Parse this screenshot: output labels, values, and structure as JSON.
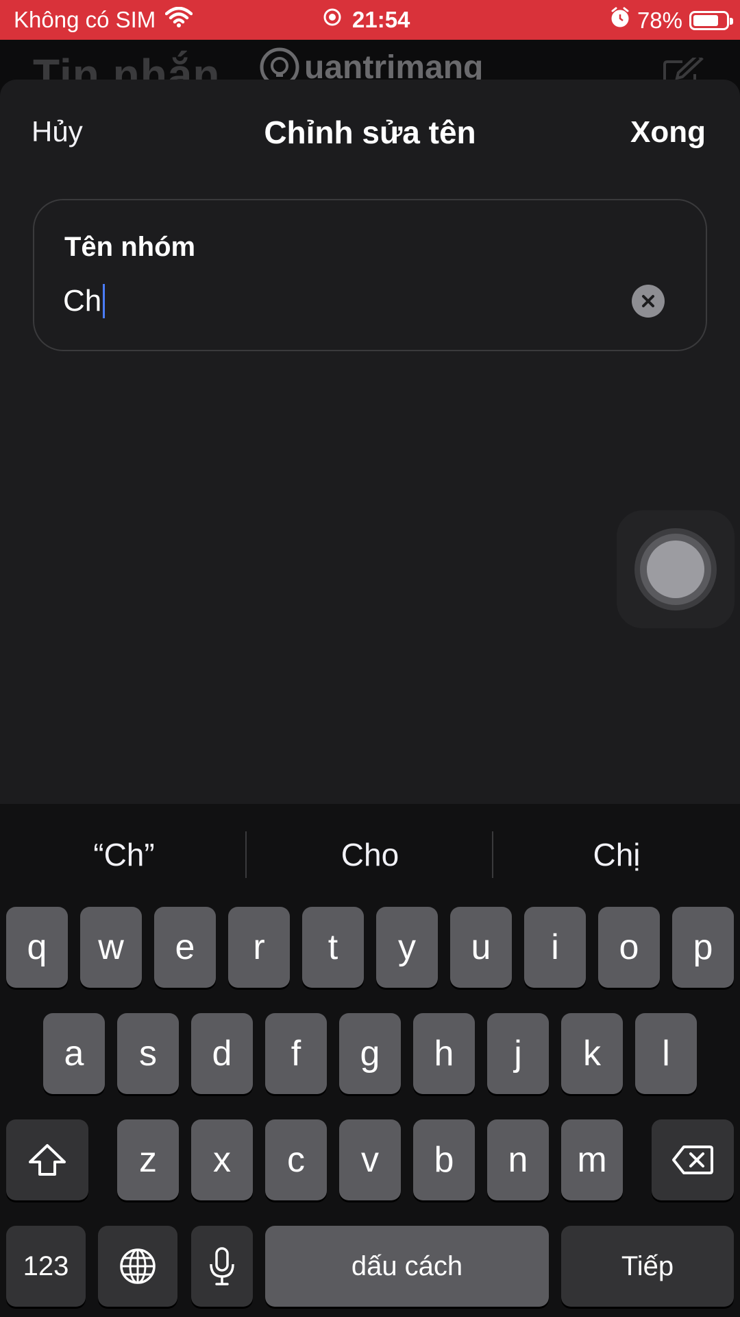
{
  "status_bar": {
    "carrier": "Không có SIM",
    "time": "21:54",
    "battery_percent": "78%",
    "battery_level": 0.78,
    "icons": [
      "wifi-icon",
      "screen-record-icon",
      "alarm-icon",
      "battery-icon"
    ],
    "background_color": "#d9323a"
  },
  "background": {
    "title": "Tin nhắn",
    "watermark": "uantrimang"
  },
  "sheet": {
    "cancel_label": "Hủy",
    "title": "Chỉnh sửa tên",
    "done_label": "Xong"
  },
  "field": {
    "label": "Tên nhóm",
    "value": "Ch"
  },
  "keyboard": {
    "suggestions": [
      "“Ch”",
      "Cho",
      "Chị"
    ],
    "row1": [
      "q",
      "w",
      "e",
      "r",
      "t",
      "y",
      "u",
      "i",
      "o",
      "p"
    ],
    "row2": [
      "a",
      "s",
      "d",
      "f",
      "g",
      "h",
      "j",
      "k",
      "l"
    ],
    "row3": [
      "z",
      "x",
      "c",
      "v",
      "b",
      "n",
      "m"
    ],
    "numbers_label": "123",
    "space_label": "dấu cách",
    "return_label": "Tiếp"
  },
  "colors": {
    "sheet_bg": "#1c1c1e",
    "key_bg": "#5b5b5f",
    "key_dark_bg": "#333335",
    "caret": "#4a7cff"
  }
}
